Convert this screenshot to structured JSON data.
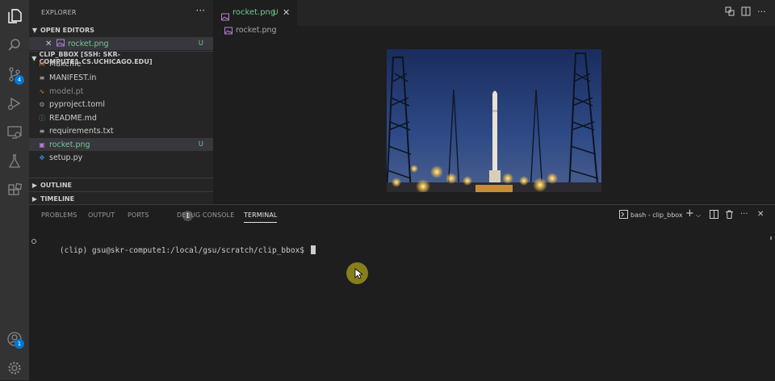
{
  "sidebar": {
    "title": "EXPLORER",
    "more": "···",
    "open_editors_label": "OPEN EDITORS",
    "open_editor": {
      "close": "✕",
      "name": "rocket.png",
      "status": "U"
    },
    "folder_label": "CLIP_BBOX [SSH: SKR-COMPUTE1.CS.UCHICAGO.EDU]",
    "files": [
      {
        "name": "Makefile",
        "icon": "makefile-icon",
        "color": "#cccccc",
        "status": ""
      },
      {
        "name": "MANIFEST.in",
        "icon": "lines-icon",
        "color": "#cccccc",
        "status": ""
      },
      {
        "name": "model.pt",
        "icon": "rss-icon",
        "color": "#8a8a8a",
        "status": ""
      },
      {
        "name": "pyproject.toml",
        "icon": "gear-icon",
        "color": "#cccccc",
        "status": ""
      },
      {
        "name": "README.md",
        "icon": "info-icon",
        "color": "#cccccc",
        "status": ""
      },
      {
        "name": "requirements.txt",
        "icon": "lines-icon",
        "color": "#cccccc",
        "status": ""
      },
      {
        "name": "rocket.png",
        "icon": "image-icon",
        "color": "#73c991",
        "status": "U"
      },
      {
        "name": "setup.py",
        "icon": "python-icon",
        "color": "#cccccc",
        "status": ""
      }
    ],
    "outline_label": "OUTLINE",
    "timeline_label": "TIMELINE"
  },
  "activity_bar": {
    "scm_badge": "4",
    "accounts_badge": "1"
  },
  "editor": {
    "tab": {
      "label": "rocket.png",
      "status": "U",
      "close": "✕"
    },
    "breadcrumb": "rocket.png"
  },
  "panel": {
    "tabs": [
      "PROBLEMS",
      "OUTPUT",
      "PORTS",
      "DEBUG CONSOLE",
      "TERMINAL"
    ],
    "ports_badge": "1",
    "active_tab": "TERMINAL",
    "terminal_name": "bash - clip_bbox",
    "prompt": "(clip) gsu@skr-compute1:/local/gsu/scratch/clip_bbox$ "
  },
  "colors": {
    "accent": "#0078d4",
    "untracked": "#73c991",
    "activity_bar": "#333333",
    "sidebar": "#252526",
    "editor": "#1e1e1e"
  }
}
